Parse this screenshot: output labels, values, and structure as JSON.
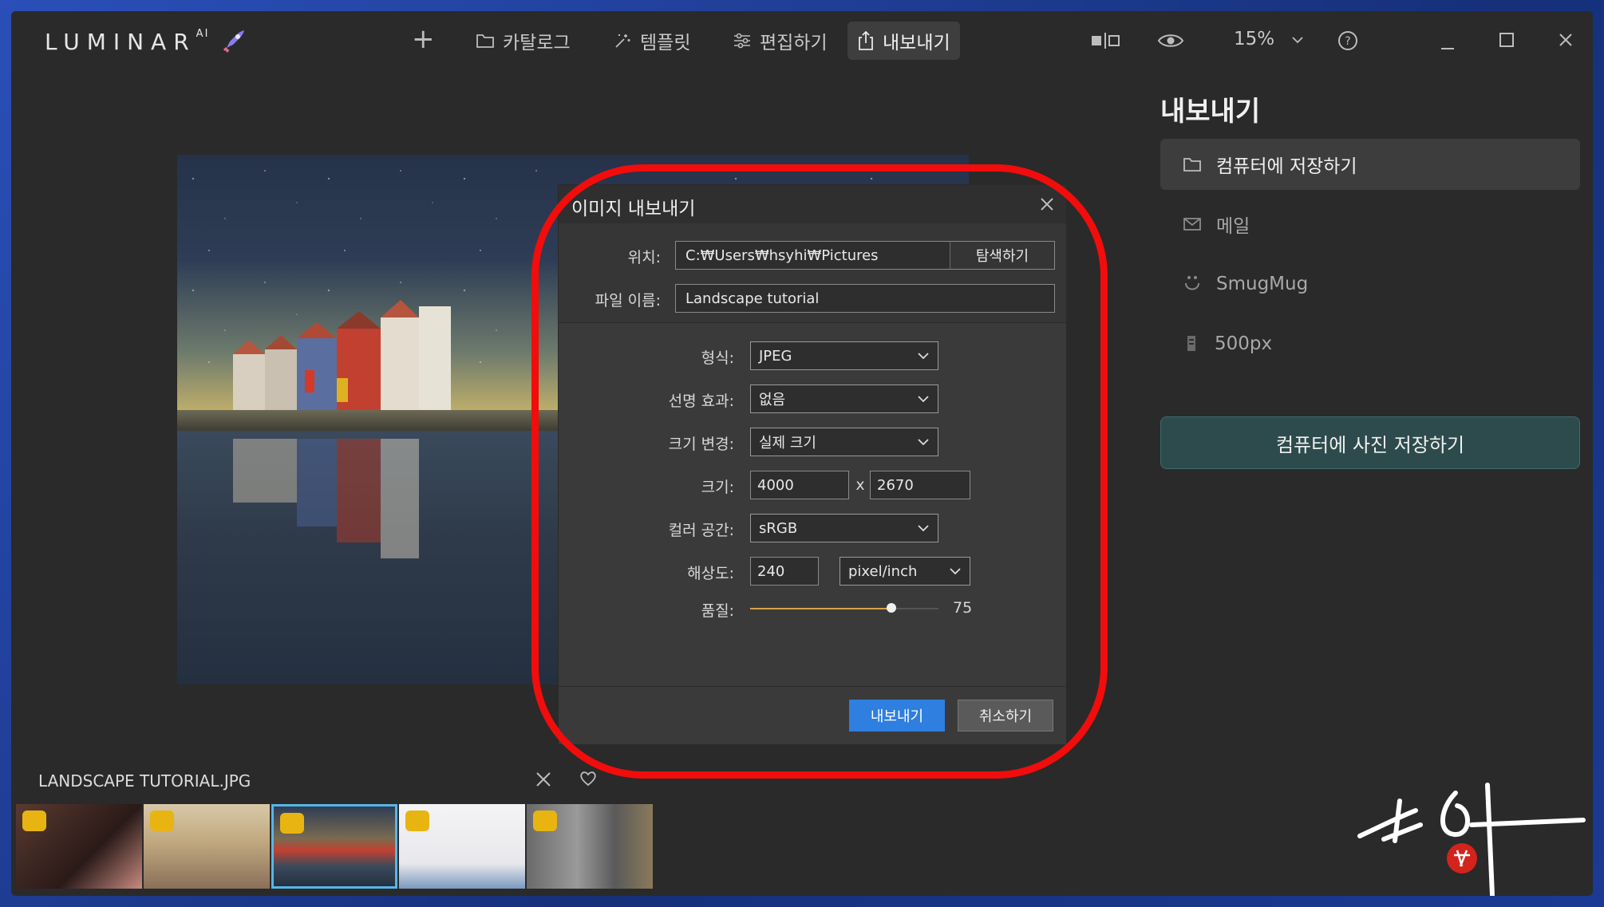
{
  "app": {
    "logo_text": "LUMINAR",
    "logo_sup": "AI"
  },
  "nav": {
    "tabs": [
      {
        "label": "카탈로그",
        "icon": "folder-icon"
      },
      {
        "label": "템플릿",
        "icon": "sparkle-icon"
      },
      {
        "label": "편집하기",
        "icon": "sliders-icon"
      },
      {
        "label": "내보내기",
        "icon": "share-icon",
        "active": true
      }
    ],
    "zoom": "15%"
  },
  "export_panel": {
    "title": "내보내기",
    "options": [
      {
        "label": "컴퓨터에 저장하기",
        "icon": "folder-icon",
        "active": true
      },
      {
        "label": "메일",
        "icon": "mail-icon"
      },
      {
        "label": "SmugMug",
        "icon": "smugmug-icon"
      },
      {
        "label": "500px",
        "icon": "500px-icon"
      }
    ],
    "save_button": "컴퓨터에 사진 저장하기"
  },
  "dialog": {
    "title": "이미지 내보내기",
    "location_label": "위치:",
    "location_value": "C:₩Users₩hsyhi₩Pictures",
    "browse_label": "탐색하기",
    "filename_label": "파일 이름:",
    "filename_value": "Landscape tutorial",
    "format_label": "형식:",
    "format_value": "JPEG",
    "sharpen_label": "선명 효과:",
    "sharpen_value": "없음",
    "resize_label": "크기 변경:",
    "resize_value": "실제 크기",
    "size_label": "크기:",
    "width": "4000",
    "size_sep": "x",
    "height": "2670",
    "colorspace_label": "컬러 공간:",
    "colorspace_value": "sRGB",
    "resolution_label": "해상도:",
    "resolution_value": "240",
    "resolution_unit": "pixel/inch",
    "quality_label": "품질:",
    "quality_value": "75",
    "quality_fraction": 0.75,
    "export_button": "내보내기",
    "cancel_button": "취소하기"
  },
  "filmstrip": {
    "title": "LANDSCAPE TUTORIAL.JPG",
    "thumbs": [
      "portrait",
      "beach",
      "houses",
      "woman-white",
      "street"
    ],
    "selected_index": 2
  },
  "colors": {
    "accent": "#2f7fe0",
    "highlight_ring": "#f20c0c",
    "save_button": "#2d4b4d",
    "selection": "#55b6e8"
  }
}
